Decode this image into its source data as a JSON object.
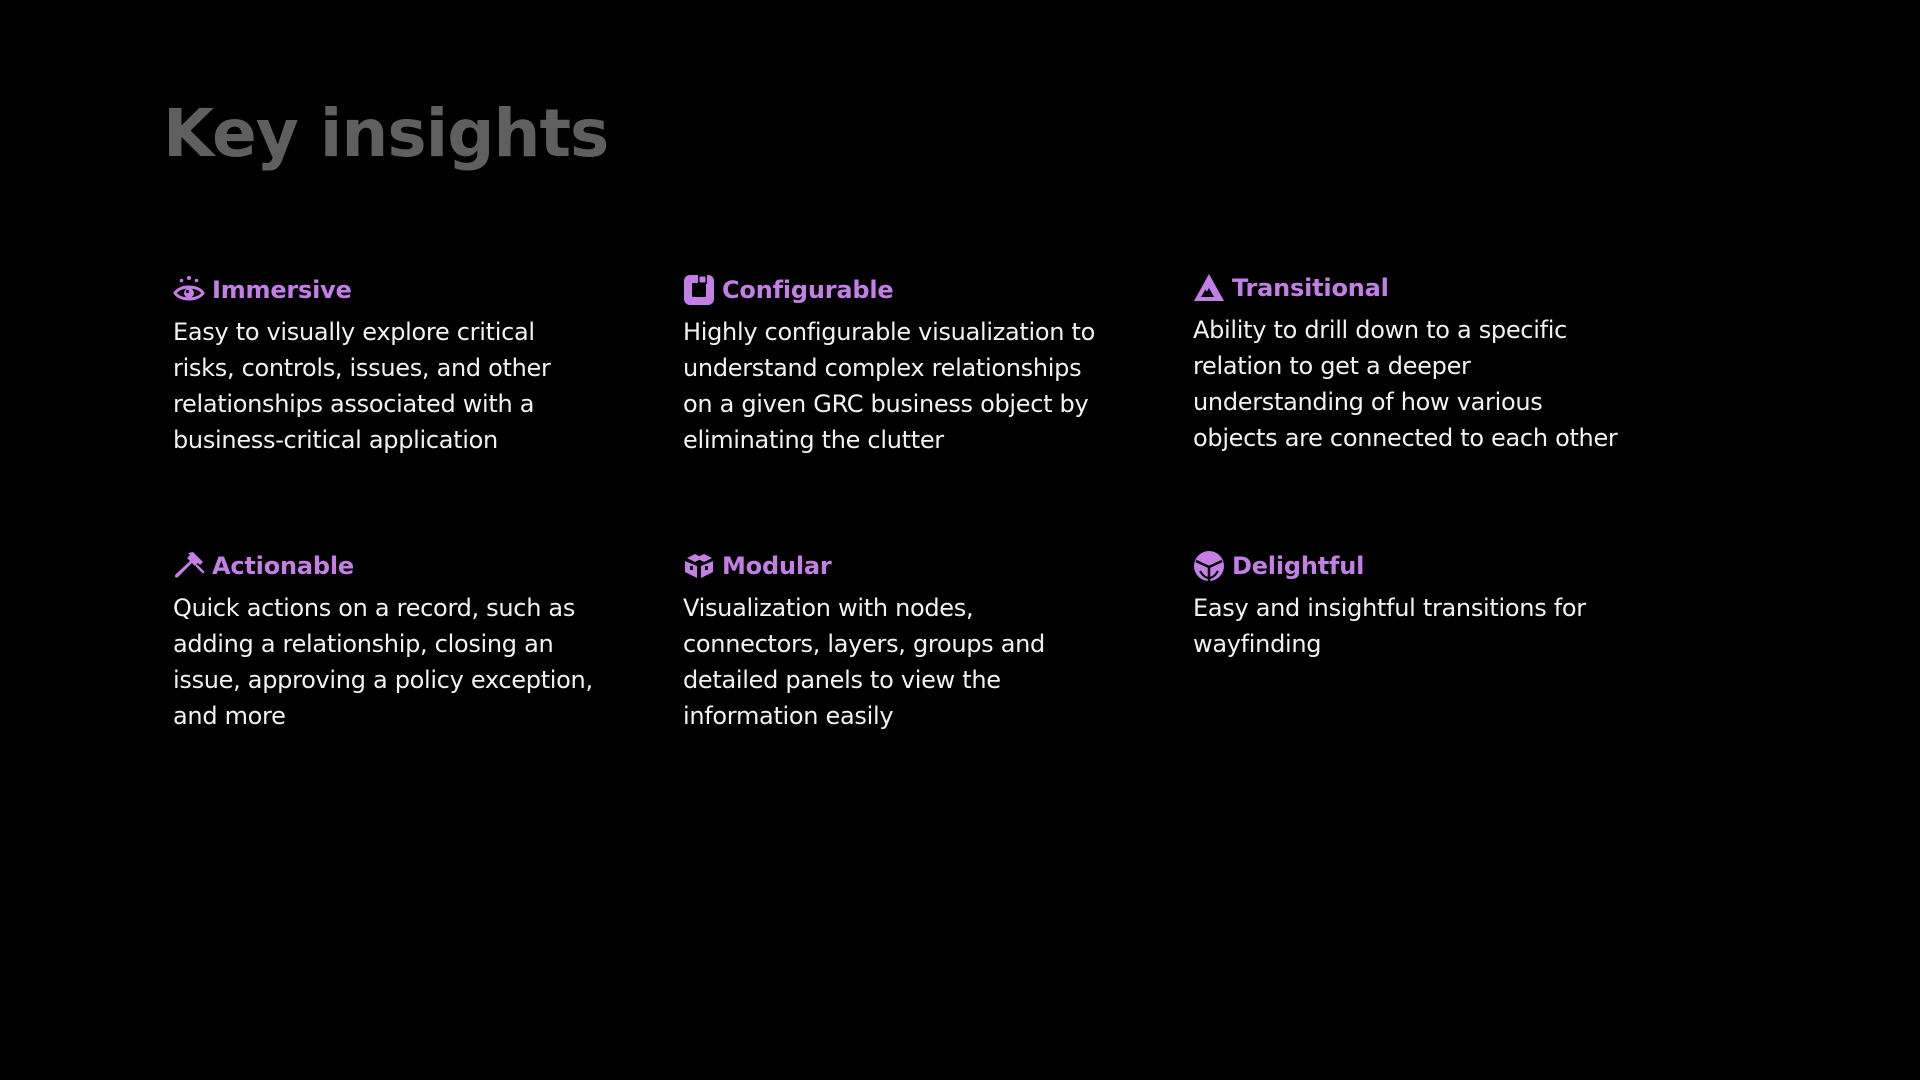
{
  "page": {
    "title": "Key insights",
    "title_color": "#5f5f5f",
    "background_color": "#000000"
  },
  "accent_color": "#c47fe6",
  "insights": [
    {
      "title": "Immersive",
      "icon": "eye-icon",
      "description": "Easy to visually explore critical risks, controls, issues, and other relationships associated with a business-critical application"
    },
    {
      "title": "Configurable",
      "icon": "configure-icon",
      "description": "Highly configurable visualization to understand complex relationships on a given GRC business object by eliminating the clutter"
    },
    {
      "title": "Transitional",
      "icon": "triangle-icon",
      "description": "Ability to drill down to a specific relation to get a deeper understanding of how various objects are connected to each other"
    },
    {
      "title": "Actionable",
      "icon": "wrench-icon",
      "description": "Quick actions on a record, such as adding a relationship, closing an issue, approving a policy exception, and more"
    },
    {
      "title": "Modular",
      "icon": "modules-icon",
      "description": "Visualization with nodes, connectors, layers, groups and detailed panels to view the information easily"
    },
    {
      "title": "Delightful",
      "icon": "delight-icon",
      "description": "Easy and insightful transitions for wayfinding"
    }
  ]
}
